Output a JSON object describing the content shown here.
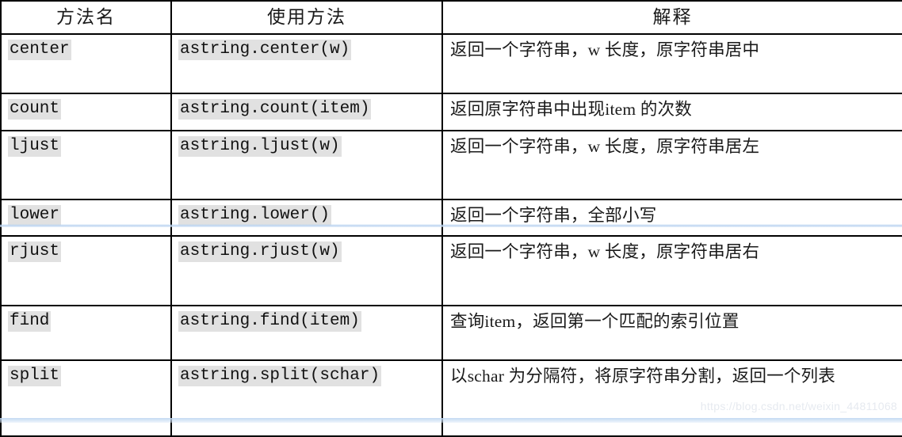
{
  "table": {
    "headers": [
      "方法名",
      "使用方法",
      "解释"
    ],
    "rows": [
      {
        "method": "center",
        "usage": "astring.center(w)",
        "explanation": "返回一个字符串，w 长度，原字符串居中"
      },
      {
        "method": "count",
        "usage": "astring.count(item)",
        "explanation": "返回原字符串中出现item 的次数"
      },
      {
        "method": "ljust",
        "usage": "astring.ljust(w)",
        "explanation": "返回一个字符串，w 长度，原字符串居左"
      },
      {
        "method": "lower",
        "usage": "astring.lower()",
        "explanation": "返回一个字符串，全部小写"
      },
      {
        "method": "rjust",
        "usage": "astring.rjust(w)",
        "explanation": "返回一个字符串，w 长度，原字符串居右"
      },
      {
        "method": "find",
        "usage": "astring.find(item)",
        "explanation": "查询item，返回第一个匹配的索引位置"
      },
      {
        "method": "split",
        "usage": "astring.split(schar)",
        "explanation": "以schar 为分隔符，将原字符串分割，返回一个列表"
      }
    ]
  },
  "watermark": {
    "text": "https://blog.csdn.net/weixin_44811068"
  },
  "colors": {
    "highlight": "#e1e1e1",
    "border": "#000000",
    "text": "#1a1a1a",
    "watermark": "#e6eaf0",
    "selection_blue": "#bad3f0"
  }
}
